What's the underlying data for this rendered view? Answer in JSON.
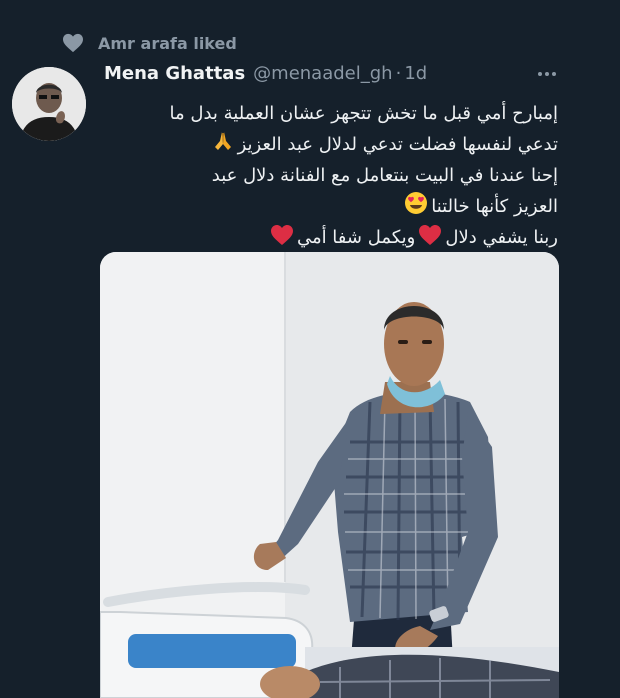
{
  "social_context": {
    "icon": "heart-icon",
    "text": "Amr arafa liked"
  },
  "tweet": {
    "author_name": "Mena Ghattas",
    "author_handle": "@menaadel_gh",
    "separator": "·",
    "time": "1d",
    "text_lines": [
      "إمبارح أمي قبل ما تخش تتجهز عشان العملية بدل ما",
      "تدعي لنفسها فضلت تدعي لدلال عبد العزيز",
      "إحنا عندنا في البيت بنتعامل مع الفنانة دلال عبد",
      "العزيز كأنها خالتنا",
      "ربنا يشفي دلال",
      "ويكمل شفا أمي"
    ],
    "emojis": {
      "pray": "folded-hands-emoji",
      "heart_eyes": "heart-eyes-emoji",
      "heart": "red-heart-emoji"
    }
  },
  "colors": {
    "background": "#15202b",
    "secondary_text": "#8b98a5",
    "primary_text": "#eef1f3"
  }
}
